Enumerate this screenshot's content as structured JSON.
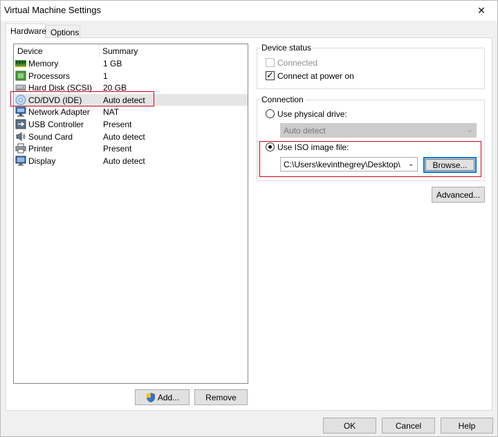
{
  "window": {
    "title": "Virtual Machine Settings",
    "close_glyph": "✕"
  },
  "tabs": [
    {
      "label": "Hardware",
      "active": true
    },
    {
      "label": "Options",
      "active": false
    }
  ],
  "device_list": {
    "col_device": "Device",
    "col_summary": "Summary",
    "rows": [
      {
        "device": "Memory",
        "summary": "1 GB",
        "icon": "memory-icon"
      },
      {
        "device": "Processors",
        "summary": "1",
        "icon": "processor-icon"
      },
      {
        "device": "Hard Disk (SCSI)",
        "summary": "20 GB",
        "icon": "hard-disk-icon"
      },
      {
        "device": "CD/DVD (IDE)",
        "summary": "Auto detect",
        "icon": "cd-dvd-icon",
        "selected": true
      },
      {
        "device": "Network Adapter",
        "summary": "NAT",
        "icon": "network-adapter-icon"
      },
      {
        "device": "USB Controller",
        "summary": "Present",
        "icon": "usb-icon"
      },
      {
        "device": "Sound Card",
        "summary": "Auto detect",
        "icon": "sound-card-icon"
      },
      {
        "device": "Printer",
        "summary": "Present",
        "icon": "printer-icon"
      },
      {
        "device": "Display",
        "summary": "Auto detect",
        "icon": "display-icon"
      }
    ]
  },
  "list_buttons": {
    "add": "Add...",
    "remove": "Remove"
  },
  "device_status": {
    "group_label": "Device status",
    "connected": "Connected",
    "connect_at_power_on": "Connect at power on"
  },
  "connection": {
    "group_label": "Connection",
    "use_physical_drive": "Use physical drive:",
    "physical_drive_value": "Auto detect",
    "use_iso": "Use ISO image file:",
    "iso_path": "C:\\Users\\kevinthegrey\\Desktop\\",
    "browse": "Browse...",
    "advanced": "Advanced..."
  },
  "footer": {
    "ok": "OK",
    "cancel": "Cancel",
    "help": "Help"
  },
  "colors": {
    "highlight_red": "#d0021b",
    "default_button_border": "#0078d7"
  }
}
